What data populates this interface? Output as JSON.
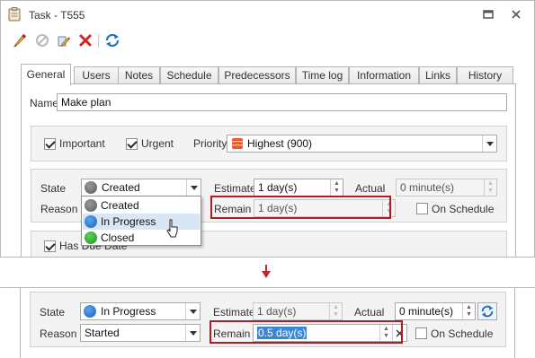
{
  "window": {
    "title": "Task - T555"
  },
  "tabs": [
    "General",
    "Users",
    "Notes",
    "Schedule",
    "Predecessors",
    "Time log",
    "Information",
    "Links",
    "History"
  ],
  "general": {
    "name_label": "Name",
    "name_value": "Make plan",
    "important_label": "Important",
    "urgent_label": "Urgent",
    "priority_label": "Priority",
    "priority_value": "Highest (900)",
    "has_due_date_label": "Has Due Date"
  },
  "before": {
    "state_label": "State",
    "state_value": "Created",
    "reason_label": "Reason",
    "estimate_label": "Estimate",
    "estimate_value": "1 day(s)",
    "actual_label": "Actual",
    "actual_value": "0 minute(s)",
    "remain_label": "Remain",
    "remain_value": "1 day(s)",
    "on_schedule_label": "On Schedule",
    "dropdown_options": [
      "Created",
      "In Progress",
      "Closed"
    ],
    "dropdown_hovered": "In Progress"
  },
  "after": {
    "state_label": "State",
    "state_value": "In Progress",
    "reason_label": "Reason",
    "reason_value": "Started",
    "estimate_label": "Estimate",
    "estimate_value": "1 day(s)",
    "actual_label": "Actual",
    "actual_value": "0 minute(s)",
    "remain_label": "Remain",
    "remain_value": "0.5 day(s)",
    "on_schedule_label": "On Schedule"
  },
  "icons": {
    "title": "clipboard-icon",
    "toolbar": [
      "pencil-icon",
      "cancel-icon",
      "edit-multi-icon",
      "delete-icon",
      "refresh-icon"
    ],
    "window": [
      "restore-icon",
      "close-icon"
    ]
  },
  "colors": {
    "highlight_border": "#b01b24",
    "arrow": "#c0232a",
    "selection": "#3a86d6",
    "hover": "#d8e6f5",
    "priority_highest": "#e8562a"
  }
}
